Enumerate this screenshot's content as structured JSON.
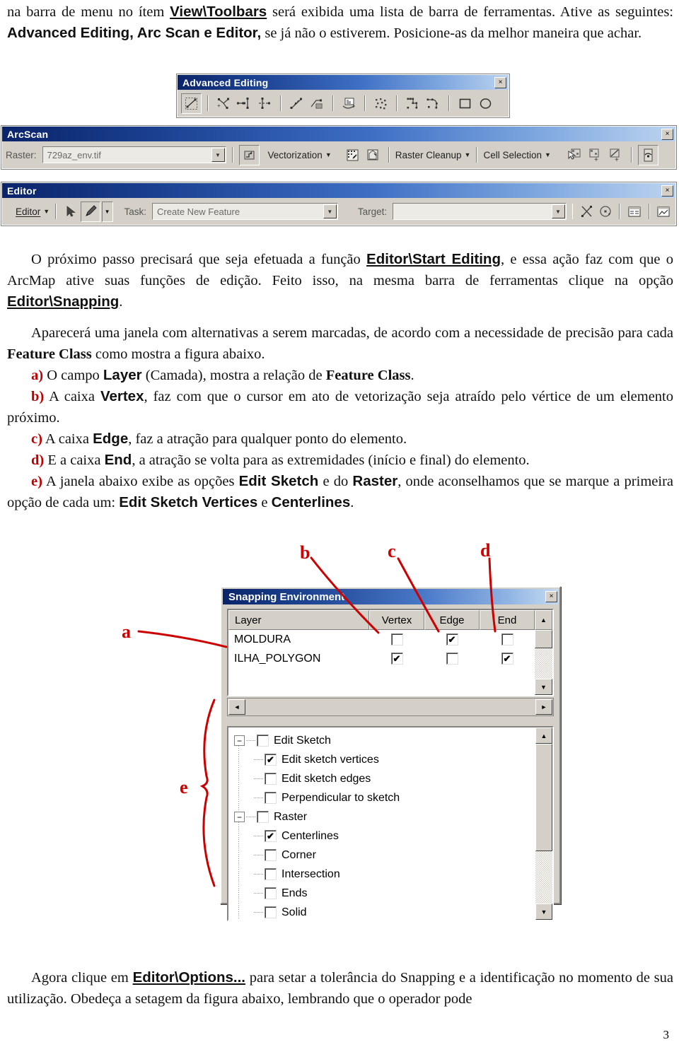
{
  "page": {
    "number": "3"
  },
  "paragraphs": {
    "intro": {
      "p1": "na barra de menu no ítem ",
      "b1": "View\\Toolbars",
      "p2": " será exibida uma lista de barra de ferramentas. Ative as seguintes: ",
      "b2": "Advanced Editing, Arc Scan e Editor,",
      "p3": " se já não o estiverem. Posicione-as da melhor maneira que achar."
    },
    "editor": {
      "p1": "O próximo passo precisará que seja efetuada a função ",
      "b1": "Editor\\Start Editing",
      "p2": ", e essa ação faz com que o ArcMap ative suas funções de edição. Feito isso, na mesma barra de ferramentas clique na opção ",
      "b2": "Editor\\Snapping",
      "p3": "."
    },
    "snapping": {
      "lead1": "Aparecerá uma janela com alternativas a serem marcadas, de acordo com a necessidade de precisão para cada  ",
      "lead_b": "Feature Class",
      "lead2": " como mostra a figura abaixo.",
      "items": [
        {
          "marker": "a)",
          "t1": " O campo ",
          "b1": "Layer",
          "t2": " (Camada), mostra a relação de ",
          "b2": "Feature Class",
          "t3": "."
        },
        {
          "marker": "b)",
          "t1": " A caixa ",
          "b1": "Vertex",
          "t2": ", faz com que o cursor em ato de vetorização seja atraído pelo vértice de um elemento próximo.",
          "b2": "",
          "t3": ""
        },
        {
          "marker": "c)",
          "t1": " A caixa ",
          "b1": "Edge",
          "t2": ", faz a atração para qualquer ponto do elemento.",
          "b2": "",
          "t3": ""
        },
        {
          "marker": "d)",
          "t1": " E a caixa ",
          "b1": "End",
          "t2": ", a atração se volta para as extremidades (início e final) do elemento.",
          "b2": "",
          "t3": ""
        },
        {
          "marker": "e)",
          "t1": " A janela abaixo exibe as opções ",
          "b1": "Edit Sketch",
          "t2": " e do ",
          "b2": "Raster",
          "t3": ", onde aconselhamos que se marque a primeira opção de cada um:  "
        }
      ],
      "tail_b1": "Edit Sketch Vertices",
      "tail_mid": " e ",
      "tail_b2": "Centerlines",
      "tail_end": "."
    },
    "options": {
      "p1": "Agora clique em ",
      "b1": "Editor\\Options...",
      "p2": " para setar a tolerância do Snapping e a identificação no momento de sua utilização. Obedeça a setagem da figura abaixo, lembrando que o operador pode"
    }
  },
  "toolbars": {
    "advanced_editing": {
      "title": "Advanced Editing",
      "close_label": "×",
      "buttons": [
        {
          "name": "reshape-feature-icon"
        },
        {
          "name": "add-vertex-icon"
        },
        {
          "name": "extend-to-icon"
        },
        {
          "name": "trim-to-icon"
        },
        {
          "name": "line-intersection-icon"
        },
        {
          "name": "proportion-icon"
        },
        {
          "name": "replace-geometry-icon"
        },
        {
          "name": "explode-multipart-icon"
        },
        {
          "name": "generalize-icon"
        },
        {
          "name": "smooth-icon"
        },
        {
          "name": "rectangle-tool-icon"
        },
        {
          "name": "circle-tool-icon"
        }
      ]
    },
    "arcscan": {
      "title": "ArcScan",
      "close_label": "×",
      "raster_label": "Raster:",
      "raster_value": "729az_env.tif",
      "vectorization_settings_icon": "vectorization-settings-icon",
      "vectorization_menu": "Vectorization",
      "raster_cleanup_menu": "Raster Cleanup",
      "cell_selection_menu": "Cell Selection",
      "dropdown_arrow": "▼",
      "buttons": [
        {
          "name": "raster-painting-icon"
        },
        {
          "name": "magic-erase-icon"
        },
        {
          "name": "select-connected-cells-icon"
        },
        {
          "name": "add-connected-cells-icon"
        },
        {
          "name": "erase-selected-cells-icon"
        },
        {
          "name": "vectorization-trace-icon"
        }
      ]
    },
    "editor": {
      "title": "Editor",
      "close_label": "×",
      "editor_menu": "Editor",
      "dropdown_arrow": "▼",
      "task_label": "Task:",
      "task_value": "Create New Feature",
      "target_label": "Target:",
      "target_value": "",
      "buttons": [
        {
          "name": "edit-tool-icon"
        },
        {
          "name": "sketch-tool-icon"
        },
        {
          "name": "sketch-tool-dropdown-icon"
        },
        {
          "name": "split-tool-icon"
        },
        {
          "name": "rotate-tool-icon"
        },
        {
          "name": "attributes-icon"
        },
        {
          "name": "sketch-properties-icon"
        }
      ]
    }
  },
  "dialog": {
    "title": "Snapping Environment",
    "close_label": "×",
    "grid": {
      "columns": [
        "Layer",
        "Vertex",
        "Edge",
        "End"
      ],
      "rows": [
        {
          "layer": "MOLDURA",
          "vertex": false,
          "edge": true,
          "end": false
        },
        {
          "layer": "ILHA_POLYGON",
          "vertex": true,
          "edge": false,
          "end": true
        }
      ],
      "scroll_up": "▲",
      "scroll_down": "▼",
      "scroll_left": "◄",
      "scroll_right": "►"
    },
    "tree": {
      "scroll_up": "▲",
      "scroll_down": "▼",
      "nodes": [
        {
          "label": "Edit Sketch",
          "level": 0,
          "expander": "−",
          "checked": false
        },
        {
          "label": "Edit sketch vertices",
          "level": 1,
          "expander": "",
          "checked": true
        },
        {
          "label": "Edit sketch edges",
          "level": 1,
          "expander": "",
          "checked": false
        },
        {
          "label": "Perpendicular to sketch",
          "level": 1,
          "expander": "",
          "checked": false
        },
        {
          "label": "Raster",
          "level": 0,
          "expander": "−",
          "checked": false
        },
        {
          "label": "Centerlines",
          "level": 1,
          "expander": "",
          "checked": true
        },
        {
          "label": "Corner",
          "level": 1,
          "expander": "",
          "checked": false
        },
        {
          "label": "Intersection",
          "level": 1,
          "expander": "",
          "checked": false
        },
        {
          "label": "Ends",
          "level": 1,
          "expander": "",
          "checked": false
        },
        {
          "label": "Solid",
          "level": 1,
          "expander": "",
          "checked": false
        }
      ]
    }
  },
  "annotations": {
    "color": "#c00000",
    "labels": [
      {
        "id": "a",
        "text": "a"
      },
      {
        "id": "b",
        "text": "b"
      },
      {
        "id": "c",
        "text": "c"
      },
      {
        "id": "d",
        "text": "d"
      },
      {
        "id": "e",
        "text": "e"
      }
    ]
  },
  "check_glyph": "✔"
}
